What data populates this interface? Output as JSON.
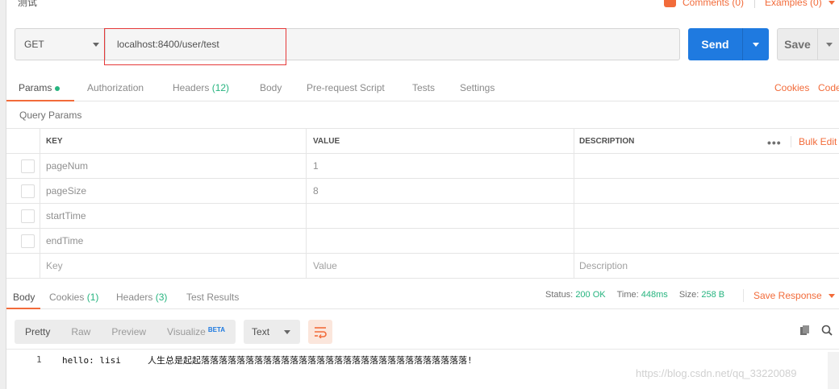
{
  "top": {
    "title": "测试",
    "comments": "Comments (0)",
    "examples": "Examples (0)"
  },
  "request": {
    "method": "GET",
    "url": "localhost:8400/user/test",
    "send_label": "Send",
    "save_label": "Save"
  },
  "req_tabs": {
    "params": "Params",
    "authorization": "Authorization",
    "headers": "Headers",
    "headers_count": "(12)",
    "body": "Body",
    "prerequest": "Pre-request Script",
    "tests": "Tests",
    "settings": "Settings",
    "cookies": "Cookies",
    "code": "Code"
  },
  "query_params": {
    "label": "Query Params",
    "col_key": "KEY",
    "col_value": "VALUE",
    "col_desc": "DESCRIPTION",
    "bulk_edit": "Bulk Edit",
    "rows": [
      {
        "key": "pageNum",
        "value": "1"
      },
      {
        "key": "pageSize",
        "value": "8"
      },
      {
        "key": "startTime",
        "value": ""
      },
      {
        "key": "endTime",
        "value": ""
      }
    ],
    "placeholder": {
      "key": "Key",
      "value": "Value",
      "desc": "Description"
    }
  },
  "response": {
    "tabs": {
      "body": "Body",
      "cookies": "Cookies",
      "cookies_count": "(1)",
      "headers": "Headers",
      "headers_count": "(3)",
      "test_results": "Test Results"
    },
    "status_label": "Status:",
    "status_value": "200 OK",
    "time_label": "Time:",
    "time_value": "448ms",
    "size_label": "Size:",
    "size_value": "258 B",
    "save_response": "Save Response",
    "views": {
      "pretty": "Pretty",
      "raw": "Raw",
      "preview": "Preview",
      "visualize": "Visualize",
      "beta": "BETA"
    },
    "format": "Text",
    "line_number": "1",
    "body_text": "hello: lisi     人生总是起起落落落落落落落落落落落落落落落落落落落落落落落落落落落落落落!"
  },
  "watermark": "https://blog.csdn.net/qq_33220089",
  "colors": {
    "accent": "#f26b3a",
    "send": "#1f7ae0",
    "ok": "#26b47f"
  }
}
